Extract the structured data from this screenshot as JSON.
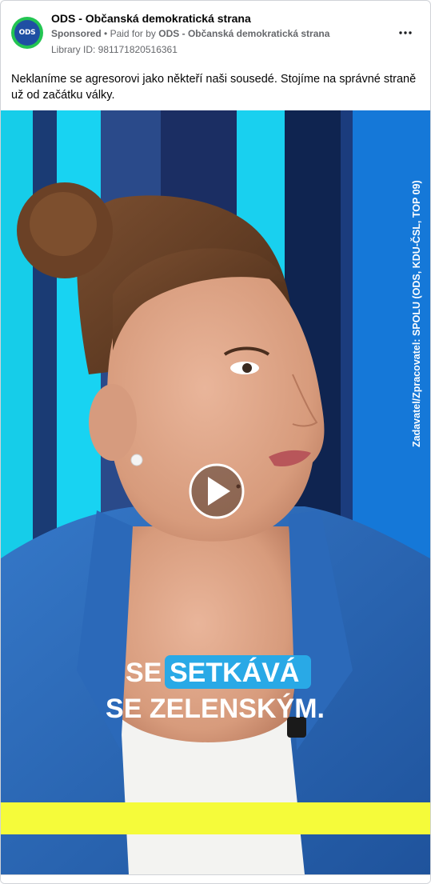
{
  "post": {
    "page_name": "ODS - Občanská demokratická strana",
    "sponsored": "Sponsored",
    "separator": "•",
    "paid_for_prefix": "Paid for by",
    "paid_for_by": "ODS - Občanská demokratická strana",
    "library_id": "Library ID: 981171820516361",
    "avatar_text": "ODS",
    "more_icon": "more-options-icon",
    "body_text": "Neklaníme se agresorovi jako někteří naši sousedé. Stojíme na správné straně už od začátku války."
  },
  "video": {
    "caption_line1_word1": "SE",
    "caption_line1_word2": "SETKÁVÁ",
    "caption_line2": "SE ZELENSKÝM.",
    "side_text": "Zadavatel/Zpracovatel: SPOLU (ODS, KDU-ČSL, TOP 09)",
    "play_icon": "play-icon"
  },
  "colors": {
    "highlight": "#29a9e6",
    "yellow_bar": "#f5fb3a",
    "blazer": "#2a67b8",
    "studio_cyan": "#17d4f4",
    "avatar_ring": "#23c552",
    "avatar_fill": "#1f4fa3"
  }
}
